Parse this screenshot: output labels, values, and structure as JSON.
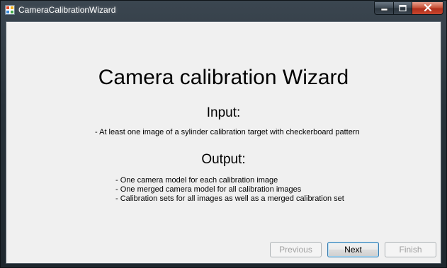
{
  "window": {
    "title": "CameraCalibrationWizard",
    "icon": "app-icon"
  },
  "caption_buttons": {
    "minimize_icon": "minimize-icon",
    "maximize_icon": "maximize-icon",
    "close_icon": "close-icon"
  },
  "content": {
    "title": "Camera calibration Wizard",
    "input_heading": "Input:",
    "input_items": [
      "- At least one image of a sylinder calibration target with checkerboard pattern"
    ],
    "output_heading": "Output:",
    "output_items": [
      "- One camera model for each calibration image",
      "- One merged camera model for all calibration images",
      "- Calibration sets for all images as well as a merged calibration set"
    ]
  },
  "buttons": {
    "previous": "Previous",
    "next": "Next",
    "finish": "Finish"
  },
  "colors": {
    "client_background": "#f0f0f0",
    "default_button_border": "#3c7fb1",
    "disabled_text": "#a0a0a0",
    "close_button": "#c8452e"
  }
}
